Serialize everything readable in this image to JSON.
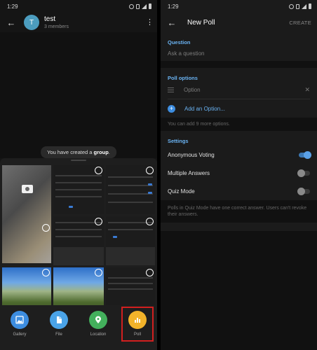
{
  "left": {
    "status": {
      "time": "1:29"
    },
    "header": {
      "avatar_letter": "T",
      "title": "test",
      "subtitle": "3 members"
    },
    "service_message": {
      "prefix": "You have created a ",
      "bold": "group",
      "suffix": "."
    },
    "attach": {
      "items": [
        {
          "label": "Gallery",
          "color": "#3d8de0",
          "icon": "gallery-icon"
        },
        {
          "label": "File",
          "color": "#4aa3e8",
          "icon": "file-icon"
        },
        {
          "label": "Location",
          "color": "#43b05c",
          "icon": "location-pin-icon"
        },
        {
          "label": "Poll",
          "color": "#f2b32a",
          "icon": "poll-chart-icon",
          "highlighted": true
        }
      ]
    }
  },
  "right": {
    "status": {
      "time": "1:29"
    },
    "header": {
      "title": "New Poll",
      "create": "CREATE"
    },
    "question": {
      "label": "Question",
      "placeholder": "Ask a question"
    },
    "options": {
      "label": "Poll options",
      "option_placeholder": "Option",
      "add": "Add an Option...",
      "hint": "You can add 9 more options."
    },
    "settings": {
      "label": "Settings",
      "toggles": [
        {
          "label": "Anonymous Voting",
          "on": true
        },
        {
          "label": "Multiple Answers",
          "on": false
        },
        {
          "label": "Quiz Mode",
          "on": false
        }
      ],
      "note": "Polls in Quiz Mode have one correct answer. Users can't revoke their answers."
    }
  }
}
